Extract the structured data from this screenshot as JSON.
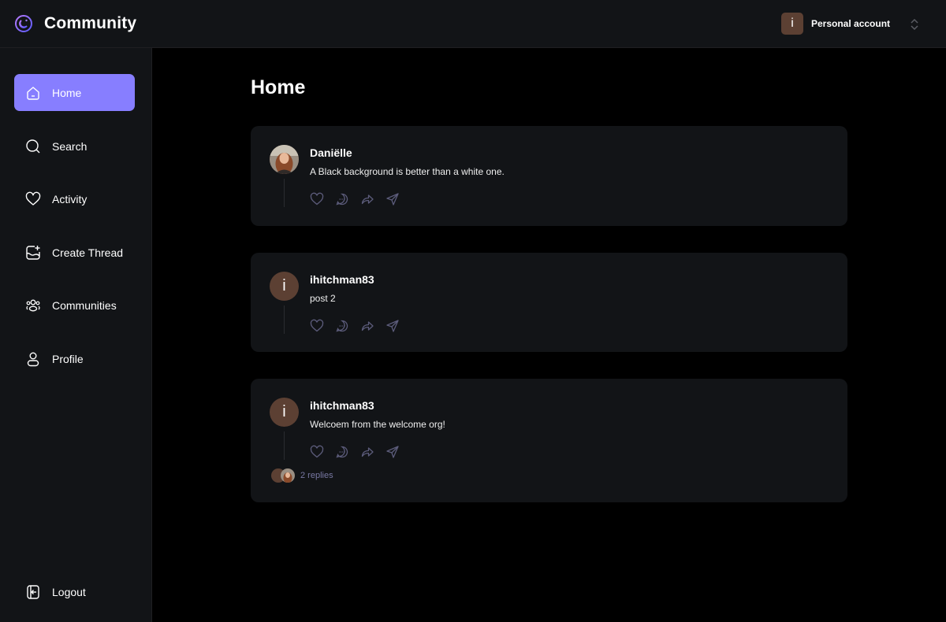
{
  "app": {
    "title": "Community",
    "logo_icon": "logo-icon"
  },
  "account": {
    "avatar_initial": "i",
    "label": "Personal account",
    "switcher_icon": "chevron-up-down-icon"
  },
  "sidebar": {
    "items": [
      {
        "label": "Home",
        "icon": "home-icon",
        "active": true
      },
      {
        "label": "Search",
        "icon": "search-icon",
        "active": false
      },
      {
        "label": "Activity",
        "icon": "heart-icon",
        "active": false
      },
      {
        "label": "Create Thread",
        "icon": "create-thread-icon",
        "active": false
      },
      {
        "label": "Communities",
        "icon": "communities-icon",
        "active": false
      },
      {
        "label": "Profile",
        "icon": "user-icon",
        "active": false
      }
    ],
    "logout": {
      "label": "Logout",
      "icon": "logout-icon"
    }
  },
  "main": {
    "title": "Home",
    "threads": [
      {
        "author": "Daniëlle",
        "avatar": "photo",
        "content": "A Black background is better than a white one.",
        "replies": null
      },
      {
        "author": "ihitchman83",
        "avatar_initial": "i",
        "content": "post 2",
        "replies": null
      },
      {
        "author": "ihitchman83",
        "avatar_initial": "i",
        "content": "Welcoem from the welcome org!",
        "replies": "2 replies"
      }
    ],
    "action_icons": [
      "heart-icon",
      "reply-icon",
      "repost-icon",
      "share-icon"
    ]
  },
  "colors": {
    "accent": "#877eff",
    "panel": "#121417",
    "background": "#000000",
    "avatar_brown": "#5c4033",
    "muted_text": "#7878a3"
  }
}
